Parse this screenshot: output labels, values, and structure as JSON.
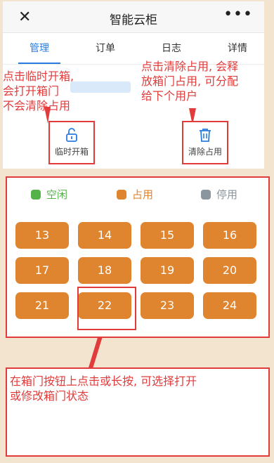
{
  "header": {
    "title": "智能云柜",
    "close_icon": "close-icon",
    "more_icon": "more-icon"
  },
  "tabs": [
    {
      "label": "管理",
      "active": true
    },
    {
      "label": "订单"
    },
    {
      "label": "日志"
    },
    {
      "label": "详情"
    }
  ],
  "actions": {
    "temp_open": {
      "label": "临时开箱",
      "icon": "unlock-icon"
    },
    "clear_occupy": {
      "label": "清除占用",
      "icon": "trash-icon"
    }
  },
  "annotations": {
    "left_line1": "点击临时开箱,",
    "left_line2": "会打开箱门",
    "left_line3": "不会清除占用",
    "right_line1": "点击清除占用, 会释",
    "right_line2": "放箱门占用, 可分配",
    "right_line3": "给下个用户",
    "bottom_line1": "在箱门按钮上点击或长按, 可选择打开",
    "bottom_line2": "或修改箱门状态"
  },
  "legend": [
    {
      "label": "空闲",
      "color": "#55b24b"
    },
    {
      "label": "占用",
      "color": "#e0852f"
    },
    {
      "label": "停用",
      "color": "#8a959e"
    }
  ],
  "doors": [
    "13",
    "14",
    "15",
    "16",
    "17",
    "18",
    "19",
    "20",
    "21",
    "22",
    "23",
    "24"
  ]
}
